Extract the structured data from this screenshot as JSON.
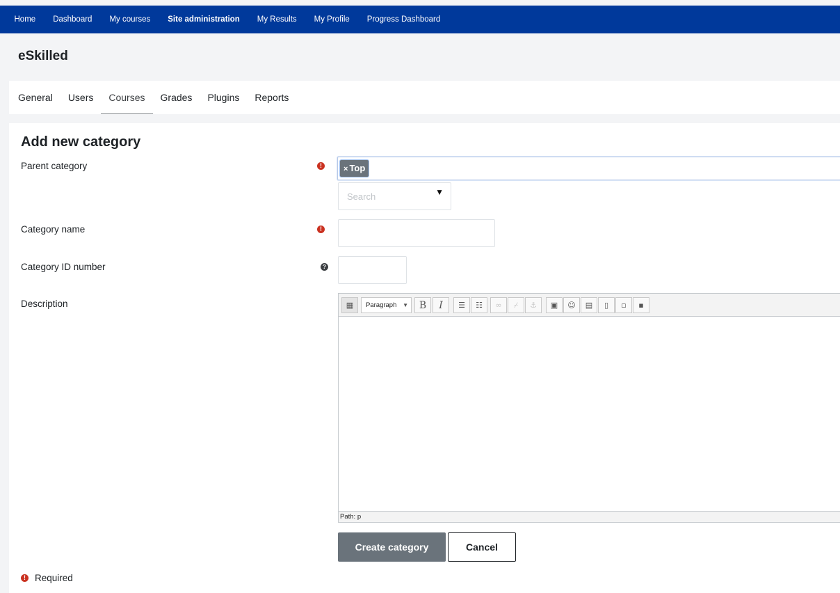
{
  "topnav": {
    "items": [
      {
        "label": "Home"
      },
      {
        "label": "Dashboard"
      },
      {
        "label": "My courses"
      },
      {
        "label": "Site administration"
      },
      {
        "label": "My Results"
      },
      {
        "label": "My Profile"
      },
      {
        "label": "Progress Dashboard"
      }
    ],
    "active": "Site administration",
    "bg_color": "#00399b"
  },
  "site": {
    "title": "eSkilled"
  },
  "secondary_nav": {
    "tabs": [
      {
        "label": "General"
      },
      {
        "label": "Users"
      },
      {
        "label": "Courses"
      },
      {
        "label": "Grades"
      },
      {
        "label": "Plugins"
      },
      {
        "label": "Reports"
      }
    ],
    "active": "Courses"
  },
  "form": {
    "title": "Add new category",
    "parent_category": {
      "label": "Parent category",
      "selected_chip": "Top",
      "chip_remove": "×",
      "search_placeholder": "Search",
      "required_icon": "exclamation-circle-icon"
    },
    "category_name": {
      "label": "Category name",
      "value": ""
    },
    "category_id": {
      "label": "Category ID number",
      "value": "",
      "help_icon": "question-circle-icon"
    },
    "description": {
      "label": "Description",
      "format_select": "Paragraph",
      "status_path": "Path: p"
    },
    "buttons": {
      "create": "Create category",
      "cancel": "Cancel"
    },
    "required_note": "Required"
  },
  "colors": {
    "required": "#ca3120",
    "primary_button": "#6a737b"
  }
}
